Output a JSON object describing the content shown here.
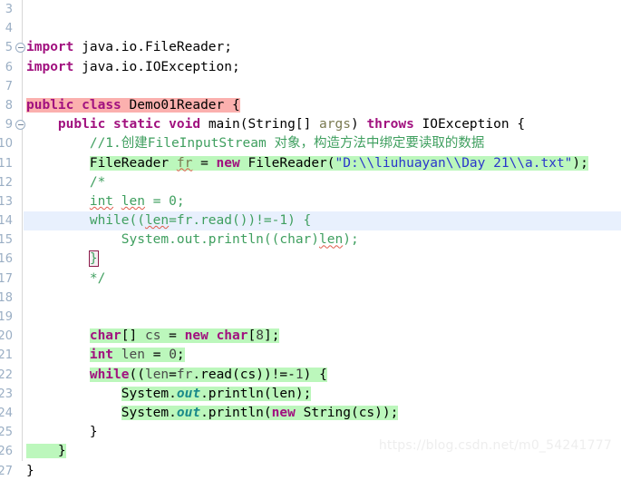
{
  "editor": {
    "language": "Java",
    "theme_colors": {
      "background": "#ffffff",
      "gutter_text": "#9aaec4",
      "keyword": "#a1117f",
      "string": "#2a37cb",
      "comment": "#3f9f5f",
      "field": "#1a8a8a",
      "highlight_green": "#bcf7bc",
      "highlight_pink": "#fbb0ae",
      "current_line": "#e8f0fd",
      "squiggle_error": "#e05b4b",
      "watermark": "#eeeeee"
    },
    "first_line_number": 3,
    "last_line_number": 27
  },
  "watermark": {
    "text": "https://blog.csdn.net/m0_54241777"
  },
  "lines": [
    {
      "number": "3",
      "fold": false,
      "highlight": "none",
      "text": ""
    },
    {
      "number": "4",
      "fold": false,
      "highlight": "none",
      "text": ""
    },
    {
      "number": "5",
      "fold": true,
      "highlight": "none",
      "text": "import java.io.FileReader;"
    },
    {
      "number": "6",
      "fold": false,
      "highlight": "none",
      "text": "import java.io.IOException;"
    },
    {
      "number": "7",
      "fold": false,
      "highlight": "none",
      "text": ""
    },
    {
      "number": "8",
      "fold": false,
      "highlight": "pink",
      "text": "public class Demo01Reader {"
    },
    {
      "number": "9",
      "fold": true,
      "highlight": "none",
      "text": "    public static void main(String[] args) throws IOException {"
    },
    {
      "number": "10",
      "fold": false,
      "highlight": "none",
      "text": "        //1.创建FileInputStream 对象，构造方法中绑定要读取的数据"
    },
    {
      "number": "11",
      "fold": false,
      "highlight": "green",
      "text": "        FileReader fr = new FileReader(\"D:\\\\liuhuayan\\\\Day 21\\\\a.txt\");"
    },
    {
      "number": "12",
      "fold": false,
      "highlight": "none",
      "text": "        /*"
    },
    {
      "number": "13",
      "fold": false,
      "highlight": "none",
      "text": "        int len = 0;"
    },
    {
      "number": "14",
      "fold": false,
      "highlight": "line",
      "text": "        while((len=fr.read())!=-1) {"
    },
    {
      "number": "15",
      "fold": false,
      "highlight": "none",
      "text": "            System.out.println((char)len);"
    },
    {
      "number": "16",
      "fold": false,
      "highlight": "none",
      "text": "        }"
    },
    {
      "number": "17",
      "fold": false,
      "highlight": "none",
      "text": "        */"
    },
    {
      "number": "18",
      "fold": false,
      "highlight": "none",
      "text": ""
    },
    {
      "number": "19",
      "fold": false,
      "highlight": "none",
      "text": ""
    },
    {
      "number": "20",
      "fold": false,
      "highlight": "green",
      "text": "        char[] cs = new char[8];"
    },
    {
      "number": "21",
      "fold": false,
      "highlight": "green",
      "text": "        int len = 0;"
    },
    {
      "number": "22",
      "fold": false,
      "highlight": "green",
      "text": "        while((len=fr.read(cs))!=-1) {"
    },
    {
      "number": "23",
      "fold": false,
      "highlight": "green",
      "text": "            System.out.println(len);"
    },
    {
      "number": "24",
      "fold": false,
      "highlight": "green",
      "text": "            System.out.println(new String(cs));"
    },
    {
      "number": "25",
      "fold": false,
      "highlight": "none",
      "text": "        }"
    },
    {
      "number": "26",
      "fold": false,
      "highlight": "green",
      "text": "    }"
    },
    {
      "number": "27",
      "fold": false,
      "highlight": "none",
      "text": "}"
    },
    {
      "number": "",
      "fold": false,
      "highlight": "none",
      "text": ""
    }
  ],
  "code_text": "import java.io.FileReader;\nimport java.io.IOException;\n\npublic class Demo01Reader {\n    public static void main(String[] args) throws IOException {\n        //1.创建FileInputStream 对象，构造方法中绑定要读取的数据\n        FileReader fr = new FileReader(\"D:\\\\liuhuayan\\\\Day 21\\\\a.txt\");\n        /*\n        int len = 0;\n        while((len=fr.read())!=-1) {\n            System.out.println((char)len);\n        }\n        */\n\n\n        char[] cs = new char[8];\n        int len = 0;\n        while((len=fr.read(cs))!=-1) {\n            System.out.println(len);\n            System.out.println(new String(cs));\n        }\n    }\n}"
}
